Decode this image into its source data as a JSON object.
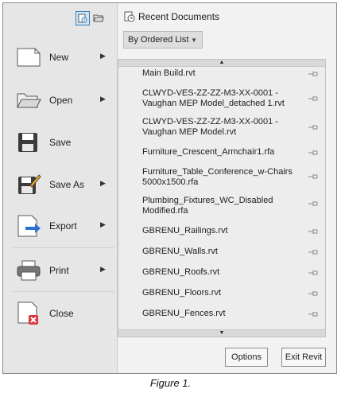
{
  "left_menu": {
    "items": [
      {
        "label": "New",
        "has_submenu": true,
        "icon": "new-document-icon"
      },
      {
        "label": "Open",
        "has_submenu": true,
        "icon": "open-folder-icon"
      },
      {
        "label": "Save",
        "has_submenu": false,
        "icon": "save-disk-icon"
      },
      {
        "label": "Save As",
        "has_submenu": true,
        "icon": "save-as-icon"
      },
      {
        "label": "Export",
        "has_submenu": true,
        "icon": "export-icon"
      },
      {
        "label": "Print",
        "has_submenu": true,
        "icon": "printer-icon"
      },
      {
        "label": "Close",
        "has_submenu": false,
        "icon": "close-document-icon"
      }
    ],
    "view_toggle": {
      "active": "recent-documents"
    }
  },
  "recent": {
    "title": "Recent Documents",
    "sort_label": "By Ordered List",
    "documents": [
      "Main Build.rvt",
      "CLWYD-VES-ZZ-ZZ-M3-XX-0001 -\nVaughan MEP Model_detached 1.rvt",
      "CLWYD-VES-ZZ-ZZ-M3-XX-0001 -\nVaughan MEP Model.rvt",
      "Furniture_Crescent_Armchair1.rfa",
      "Furniture_Table_Conference_w-Chairs\n5000x1500.rfa",
      "Plumbing_Fixtures_WC_Disabled\nModified.rfa",
      "GBRENU_Railings.rvt",
      "GBRENU_Walls.rvt",
      "GBRENU_Roofs.rvt",
      "GBRENU_Floors.rvt",
      "GBRENU_Fences.rvt"
    ]
  },
  "footer": {
    "options_label": "Options",
    "exit_label": "Exit Revit"
  },
  "caption": "Figure 1.",
  "colors": {
    "accent": "#3c7fb1",
    "close_red": "#d9373a",
    "export_blue": "#2f6fd0"
  }
}
